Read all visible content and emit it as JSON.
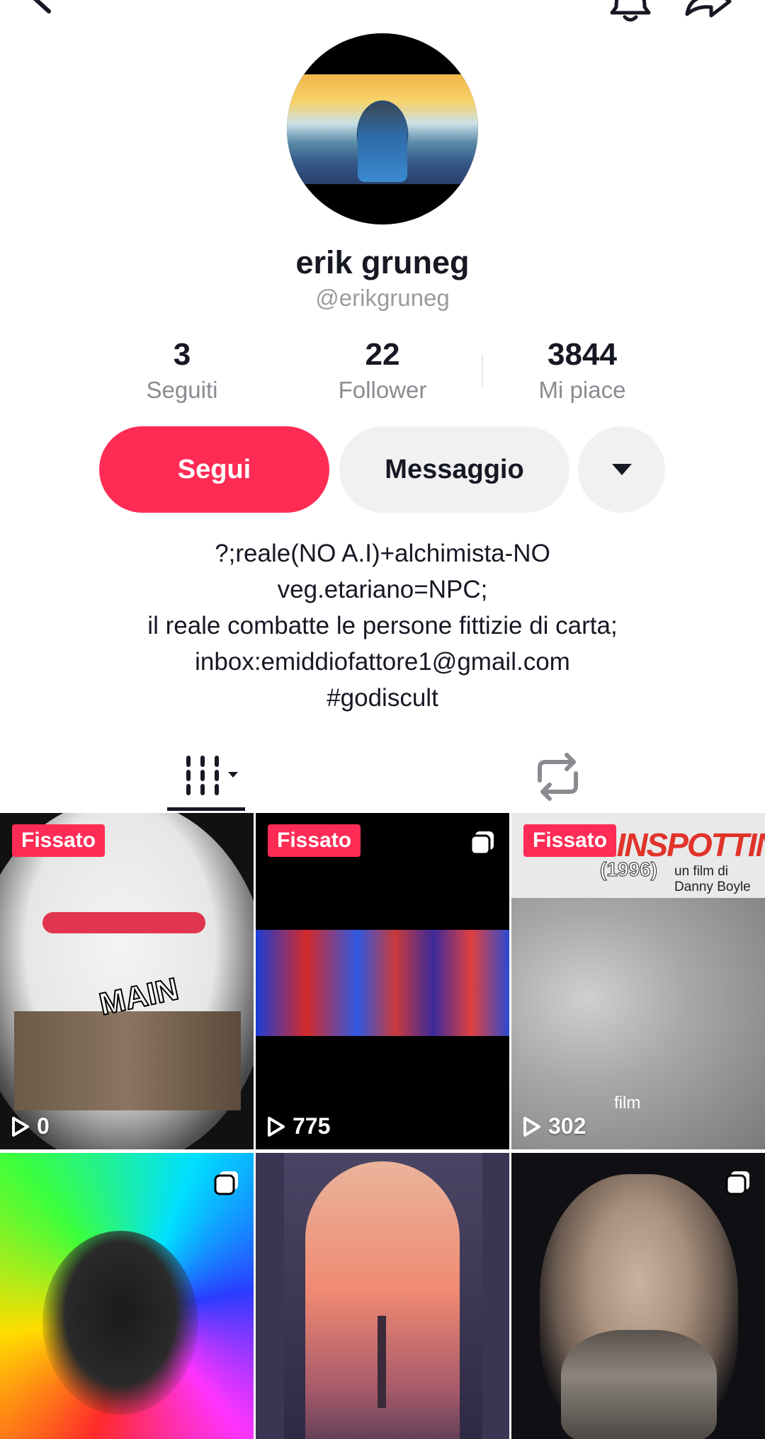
{
  "profile": {
    "name": "erik gruneg",
    "handle": "@erikgruneg"
  },
  "stats": [
    {
      "value": "3",
      "label": "Seguiti"
    },
    {
      "value": "22",
      "label": "Follower"
    },
    {
      "value": "3844",
      "label": "Mi piace"
    }
  ],
  "actions": {
    "follow_label": "Segui",
    "message_label": "Messaggio"
  },
  "bio": [
    "?;reale(NO A.I)+alchimista-NO",
    "veg.etariano=NPC;",
    "il reale combatte le persone fittizie di carta;",
    "inbox:emiddiofattore1@gmail.com",
    "#godiscult"
  ],
  "icons": {
    "back": "arrow-left-icon",
    "bell": "bell-icon",
    "share": "share-icon",
    "more": "caret-down-icon",
    "videos_tab": "grid-icon",
    "repost_tab": "repost-icon"
  },
  "colors": {
    "accent": "#fe2c55",
    "text": "#161823",
    "muted": "#8a8b91",
    "button_bg": "#f1f1f2"
  },
  "videos": [
    {
      "badge": "Fissato",
      "views": "0",
      "thumb_text": "MAIN"
    },
    {
      "badge": "Fissato",
      "views": "775",
      "multi": true
    },
    {
      "badge": "Fissato",
      "views": "302",
      "thumb_title": "TRAINSPOTTING",
      "thumb_year": "(1996)",
      "thumb_credit": "un film di Danny Boyle",
      "thumb_caption": "film"
    },
    {
      "multi": true
    },
    {},
    {
      "multi": true
    }
  ]
}
